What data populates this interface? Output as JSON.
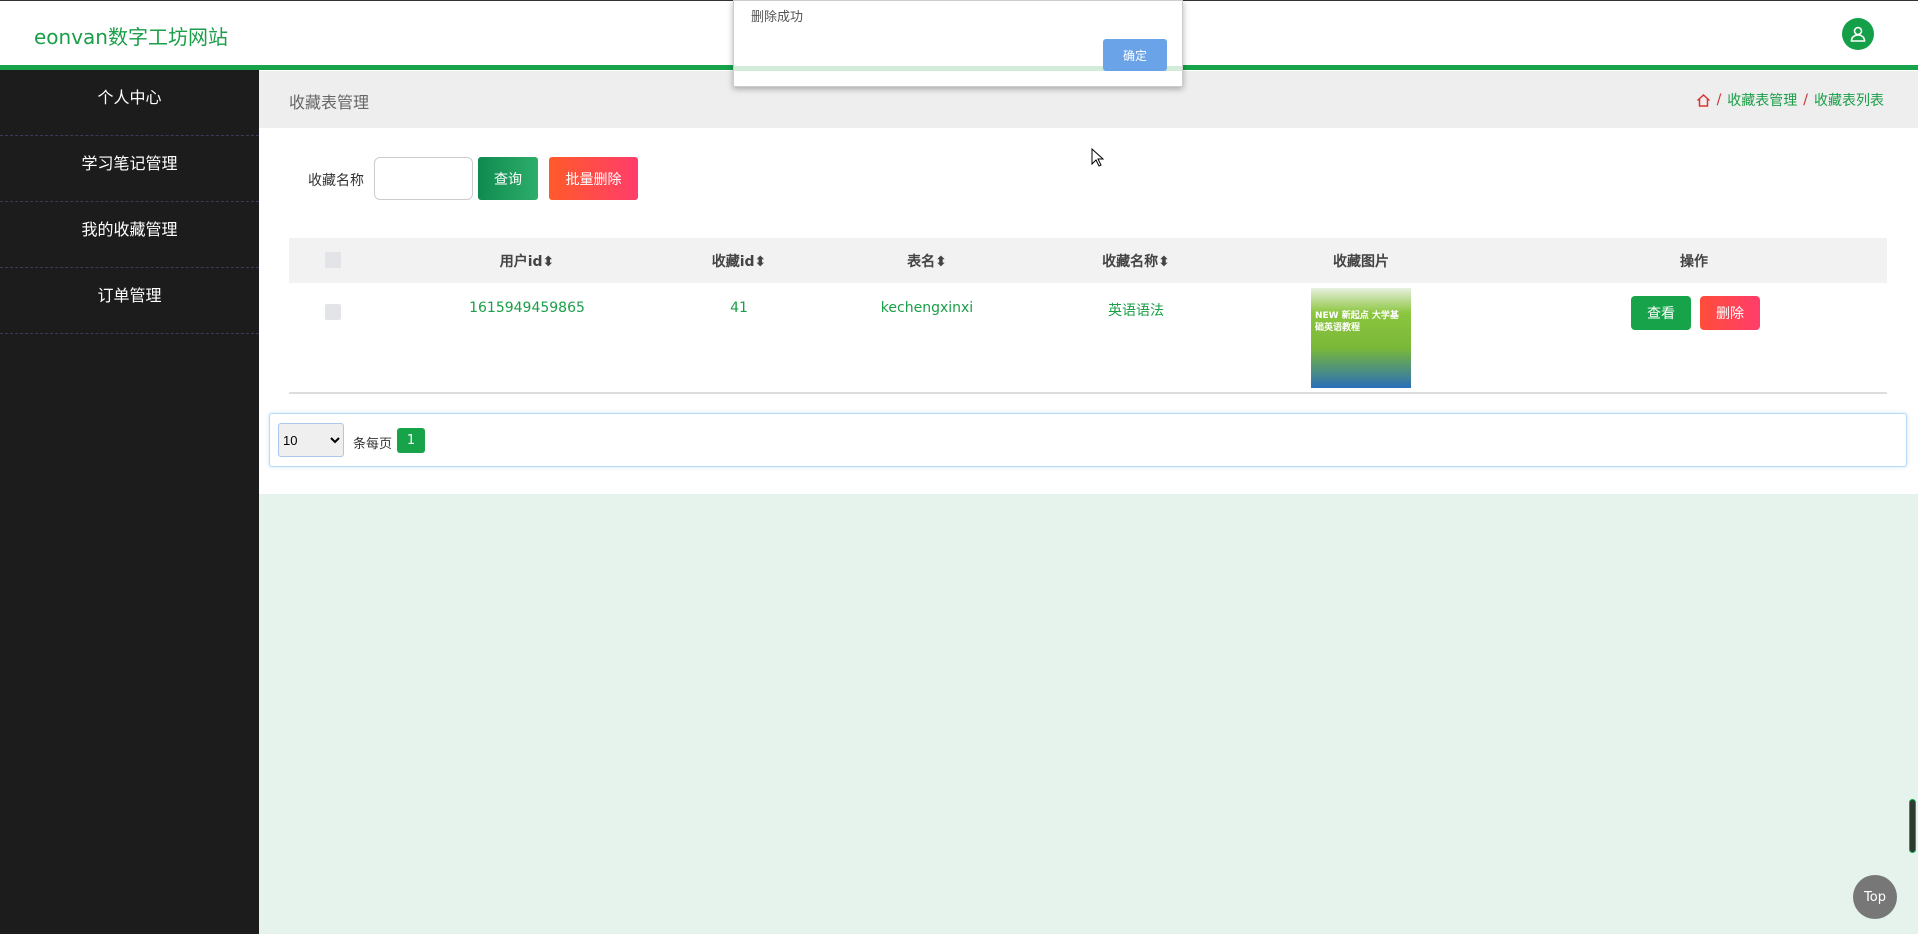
{
  "header": {
    "brand": "eonvan数字工坊网站",
    "avatar_icon": "user-icon"
  },
  "sidebar": {
    "items": [
      {
        "label": "个人中心"
      },
      {
        "label": "学习笔记管理"
      },
      {
        "label": "我的收藏管理"
      },
      {
        "label": "订单管理"
      }
    ]
  },
  "page": {
    "title": "收藏表管理",
    "breadcrumb": [
      "收藏表管理",
      "收藏表列表"
    ],
    "sep": "/"
  },
  "search": {
    "label": "收藏名称",
    "value": "",
    "query_button": "查询",
    "batch_delete_button": "批量删除"
  },
  "table": {
    "headers": [
      "用户id",
      "收藏id",
      "表名",
      "收藏名称",
      "收藏图片",
      "操作"
    ],
    "sort_glyph": "⬍",
    "rows": [
      {
        "userid": "1615949459865",
        "refid": "41",
        "tablename": "kechengxinxi",
        "name": "英语语法",
        "image_text": "NEW 新起点 大学基础英语教程",
        "view": "查看",
        "delete": "删除"
      }
    ]
  },
  "pagination": {
    "page_size": "10",
    "page_size_label": "条每页",
    "current_page": "1"
  },
  "dialog": {
    "message": "删除成功",
    "ok": "确定"
  },
  "top_button": "Top",
  "colors": {
    "green": "#16a34a",
    "red": "#ff4d4f",
    "dialog_btn": "#6aa3e8"
  }
}
